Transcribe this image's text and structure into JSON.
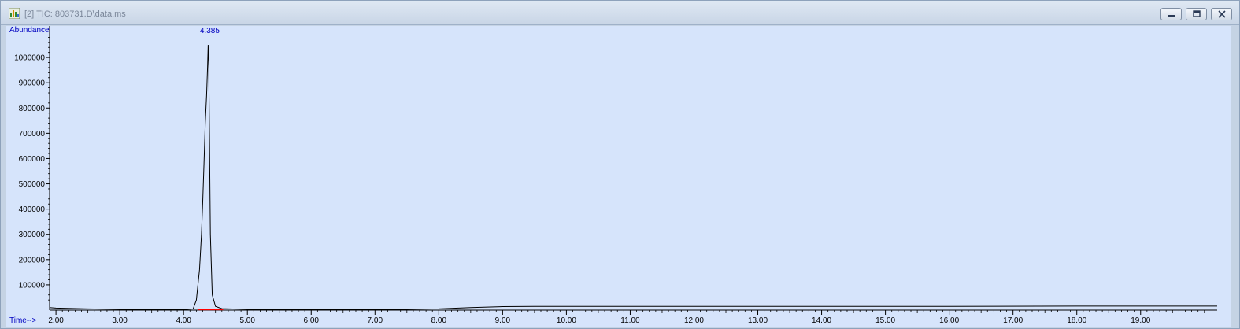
{
  "window": {
    "title": "[2] TIC: 803731.D\\data.ms"
  },
  "icons": {
    "app": "chromatogram-app-icon",
    "minimize": "minimize-icon",
    "restore": "restore-icon",
    "close": "close-icon"
  },
  "colors": {
    "plot_background": "#d6e4fb",
    "trace": "#000000",
    "baseline_marker": "#ff0000",
    "label_text": "#0000c0"
  },
  "chart_data": {
    "type": "line",
    "ylabel": "Abundance",
    "xlabel": "Time-->",
    "xlim": [
      1.9,
      20.2
    ],
    "ylim": [
      0,
      1100000
    ],
    "x_ticks": [
      "2.00",
      "3.00",
      "4.00",
      "5.00",
      "6.00",
      "7.00",
      "8.00",
      "9.00",
      "10.00",
      "11.00",
      "12.00",
      "13.00",
      "14.00",
      "15.00",
      "16.00",
      "17.00",
      "18.00",
      "19.00"
    ],
    "y_ticks": [
      "100000",
      "200000",
      "300000",
      "400000",
      "500000",
      "600000",
      "700000",
      "800000",
      "900000",
      "1000000"
    ],
    "peak_label": "4.385",
    "peak": {
      "x": 4.385,
      "y": 1050000
    },
    "baseline_segment": {
      "x_start": 4.22,
      "x_end": 4.62,
      "y": 2000
    },
    "series": [
      {
        "x": [
          1.9,
          2.0,
          2.5,
          3.0,
          3.5,
          3.8,
          4.0,
          4.15,
          4.2,
          4.25,
          4.28,
          4.3,
          4.32,
          4.34,
          4.36,
          4.375,
          4.385,
          4.395,
          4.405,
          4.42,
          4.45,
          4.5,
          4.6,
          5.0,
          6.0,
          7.0,
          7.5,
          8.0,
          8.5,
          9.0,
          9.5,
          10.0,
          12.0,
          14.0,
          16.0,
          18.0,
          20.2
        ],
        "y": [
          10000,
          8000,
          5000,
          3000,
          2000,
          2000,
          2000,
          5000,
          40000,
          160000,
          300000,
          430000,
          580000,
          740000,
          850000,
          960000,
          1050000,
          960000,
          700000,
          300000,
          60000,
          15000,
          6000,
          3000,
          2000,
          2000,
          3000,
          5000,
          10000,
          14000,
          15000,
          15000,
          15000,
          15000,
          15000,
          16000,
          16000
        ]
      }
    ]
  }
}
